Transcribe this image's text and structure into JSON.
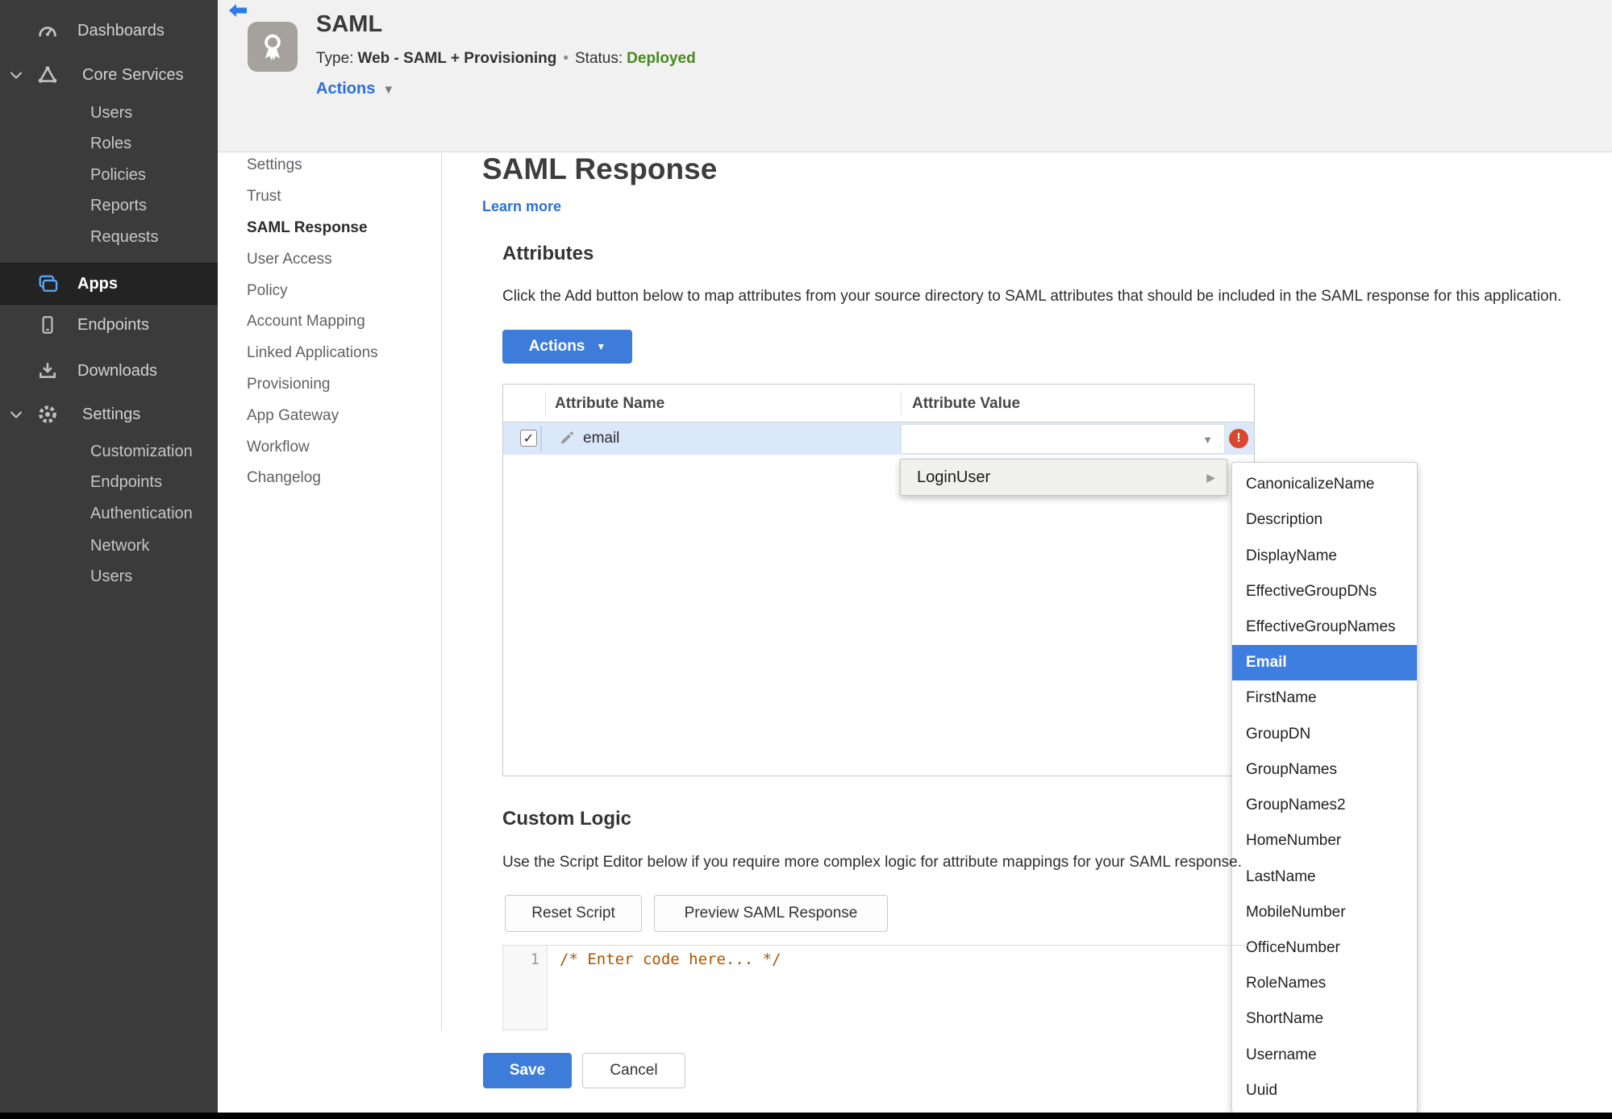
{
  "colors": {
    "accent_blue": "#3d7cd9",
    "link_blue": "#2e6fd8",
    "menu_highlight_blue": "#3e7ee0",
    "status_green": "#478a1d",
    "error_red": "#d9472e",
    "sidebar_bg": "#3b3b3c",
    "sidebar_selected_bg": "#232324",
    "header_bg": "#f1f1f2",
    "row_highlight": "#dbe8fa",
    "code_comment": "#aa5500"
  },
  "icons": {
    "caret_down": "▼",
    "submenu_arrow": "▶",
    "checkmark": "✓",
    "error_mark": "!"
  },
  "sidebar": {
    "items": [
      {
        "label": "Dashboards"
      },
      {
        "label": "Core Services"
      },
      {
        "label": "Users"
      },
      {
        "label": "Roles"
      },
      {
        "label": "Policies"
      },
      {
        "label": "Reports"
      },
      {
        "label": "Requests"
      },
      {
        "label": "Apps",
        "selected": true
      },
      {
        "label": "Endpoints"
      },
      {
        "label": "Downloads"
      },
      {
        "label": "Settings"
      },
      {
        "label": "Customization"
      },
      {
        "label": "Endpoints"
      },
      {
        "label": "Authentication"
      },
      {
        "label": "Network"
      },
      {
        "label": "Users"
      }
    ]
  },
  "header": {
    "title": "SAML",
    "type_label": "Type:",
    "type_value": "Web - SAML + Provisioning",
    "dot": "•",
    "status_label": "Status:",
    "status_value": "Deployed",
    "actions_label": "Actions"
  },
  "subnav": {
    "items": [
      {
        "label": "Settings"
      },
      {
        "label": "Trust"
      },
      {
        "label": "SAML Response",
        "active": true
      },
      {
        "label": "User Access"
      },
      {
        "label": "Policy"
      },
      {
        "label": "Account Mapping"
      },
      {
        "label": "Linked Applications"
      },
      {
        "label": "Provisioning"
      },
      {
        "label": "App Gateway"
      },
      {
        "label": "Workflow"
      },
      {
        "label": "Changelog"
      }
    ]
  },
  "main": {
    "page_title": "SAML Response",
    "learn_more": "Learn more",
    "attributes": {
      "heading": "Attributes",
      "description": "Click the Add button below to map attributes from your source directory to SAML attributes that should be included in the SAML response for this application.",
      "actions_button": "Actions",
      "table": {
        "col_name": "Attribute Name",
        "col_value": "Attribute Value",
        "row": {
          "name": "email",
          "value": "",
          "checked": true,
          "has_error": true
        }
      }
    },
    "context_menu": {
      "label": "LoginUser",
      "selected_item": "Email",
      "submenu": [
        "CanonicalizeName",
        "Description",
        "DisplayName",
        "EffectiveGroupDNs",
        "EffectiveGroupNames",
        "Email",
        "FirstName",
        "GroupDN",
        "GroupNames",
        "GroupNames2",
        "HomeNumber",
        "LastName",
        "MobileNumber",
        "OfficeNumber",
        "RoleNames",
        "ShortName",
        "Username",
        "Uuid"
      ]
    },
    "custom_logic": {
      "heading": "Custom Logic",
      "description": "Use the Script Editor below if you require more complex logic for attribute mappings for your SAML response.",
      "reset_button": "Reset Script",
      "preview_button": "Preview SAML Response",
      "editor": {
        "line_number": "1",
        "code": "/* Enter code here... */"
      }
    },
    "footer": {
      "save": "Save",
      "cancel": "Cancel"
    }
  }
}
